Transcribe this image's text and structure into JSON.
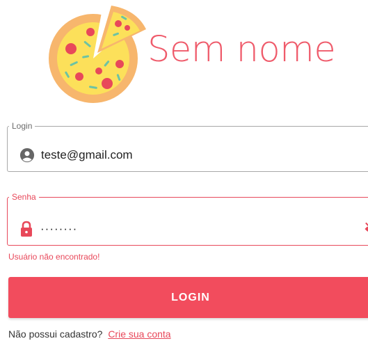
{
  "brand": {
    "name": "Sem nome",
    "color": "#ef5b6b"
  },
  "login_field": {
    "label": "Login",
    "value": "teste@gmail.com",
    "icon": "account-circle-icon"
  },
  "password_field": {
    "label": "Senha",
    "masked_value": "········",
    "icon": "lock-icon",
    "toggle_icon": "eye-off-icon",
    "accent_color": "#e8485a"
  },
  "error_message": "Usuário não encontrado!",
  "login_button": {
    "label": "LOGIN",
    "color": "#f24c5d"
  },
  "signup": {
    "prompt": "Não possui cadastro?",
    "link_label": "Crie sua conta"
  }
}
